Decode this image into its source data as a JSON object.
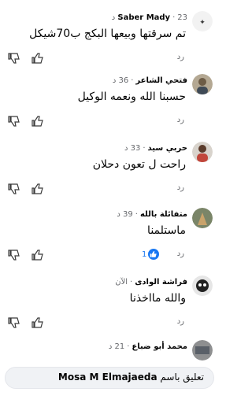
{
  "comments": [
    {
      "author": "Saber Mady",
      "time": "23 د",
      "text": "تم سرقتها وبيعها البكج ب70شيكل",
      "reply": "رد",
      "avatar_color": "#f2f2f2"
    },
    {
      "author": "فتحي الشاعر",
      "time": "36 د",
      "text": "حسبنا الله ونعمه الوكيل",
      "reply": "رد",
      "avatar_color": "#b4a893"
    },
    {
      "author": "حربي سيد",
      "time": "33 د",
      "text": "راحت ل تعون دحلان",
      "reply": "رد",
      "avatar_color": "#c1463b"
    },
    {
      "author": "متفائلة بالله",
      "time": "39 د",
      "text": "ماستلمنا",
      "reply": "رد",
      "reaction_count": "1",
      "avatar_color": "#7a8568"
    },
    {
      "author": "فراشة الوادى",
      "time": "الآن",
      "text": "والله مااخذنا",
      "reply": "رد",
      "avatar_color": "#e6e6e6"
    },
    {
      "author": "محمد أبو ضباع",
      "time": "21 د",
      "text": "",
      "reply": "",
      "avatar_color": "#8e8f90"
    }
  ],
  "bottom_bar": {
    "prefix": "تعليق باسم",
    "user": "Mosa M Elmajaeda"
  },
  "colors": {
    "secondary_text": "#65676b",
    "like_blue": "#1877f2",
    "input_bg": "#f0f2f5"
  },
  "icons": {
    "like": "thumbs-up-icon",
    "dislike": "thumbs-down-icon",
    "reaction": "like-reaction-icon"
  }
}
